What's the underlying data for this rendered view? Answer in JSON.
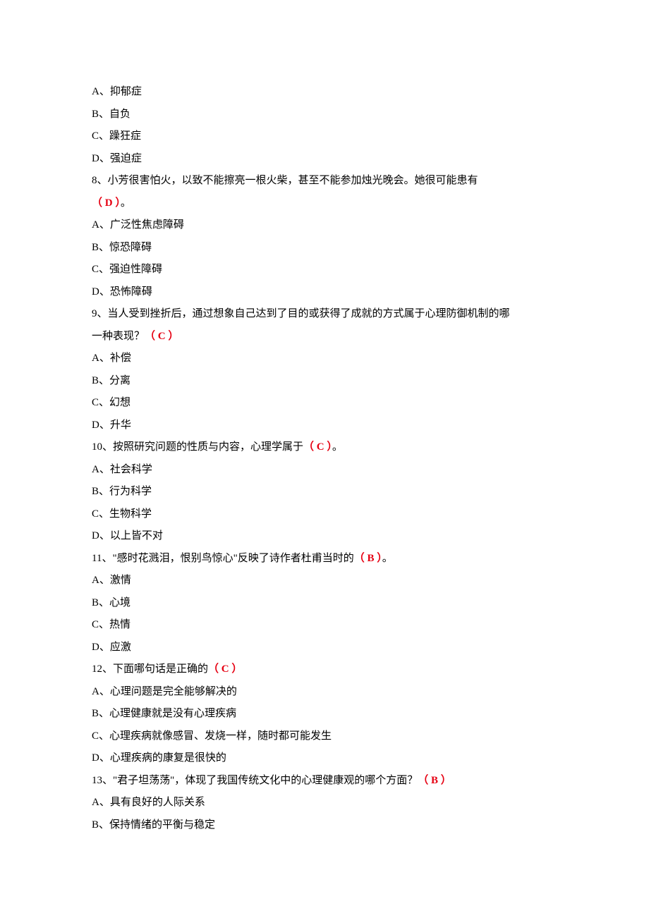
{
  "q7": {
    "optA": "A、抑郁症",
    "optB": "B、自负",
    "optC": "C、躁狂症",
    "optD": "D、强迫症"
  },
  "q8": {
    "stem1": "8、小芳很害怕火，以致不能擦亮一根火柴，甚至不能参加烛光晚会。她很可能患有",
    "ans": "（ D  ）",
    "ans_after": "。",
    "optA": "A、广泛性焦虑障碍",
    "optB": "B、惊恐障碍",
    "optC": "C、强迫性障碍",
    "optD": "D、恐怖障碍"
  },
  "q9": {
    "stem1": "9、当人受到挫折后，通过想象自己达到了目的或获得了成就的方式属于心理防御机制的哪",
    "stem2": "一种表现？",
    "ans": "（ C ）",
    "optA": "A、补偿",
    "optB": "B、分离",
    "optC": "C、幻想",
    "optD": "D、升华"
  },
  "q10": {
    "stem": "10、按照研究问题的性质与内容，心理学属于",
    "ans": "（ C ）",
    "ans_after": "。",
    "optA": "A、社会科学",
    "optB": "B、行为科学",
    "optC": "C、生物科学",
    "optD": "D、以上皆不对"
  },
  "q11": {
    "stem": "11、\"感时花溅泪，恨别鸟惊心\"反映了诗作者杜甫当时的",
    "ans": "（ B ）",
    "ans_after": "。",
    "optA": "A、激情",
    "optB": "B、心境",
    "optC": "C、热情",
    "optD": "D、应激"
  },
  "q12": {
    "stem": "12、下面哪句话是正确的",
    "ans": "（  C  ）",
    "optA": "A、心理问题是完全能够解决的",
    "optB": "B、心理健康就是没有心理疾病",
    "optC": "C、心理疾病就像感冒、发烧一样，随时都可能发生",
    "optD": "D、心理疾病的康复是很快的"
  },
  "q13": {
    "stem": "13、\"君子坦荡荡\"，体现了我国传统文化中的心理健康观的哪个方面？",
    "ans": "（  B ）",
    "optA": "A、具有良好的人际关系",
    "optB": "B、保持情绪的平衡与稳定"
  }
}
